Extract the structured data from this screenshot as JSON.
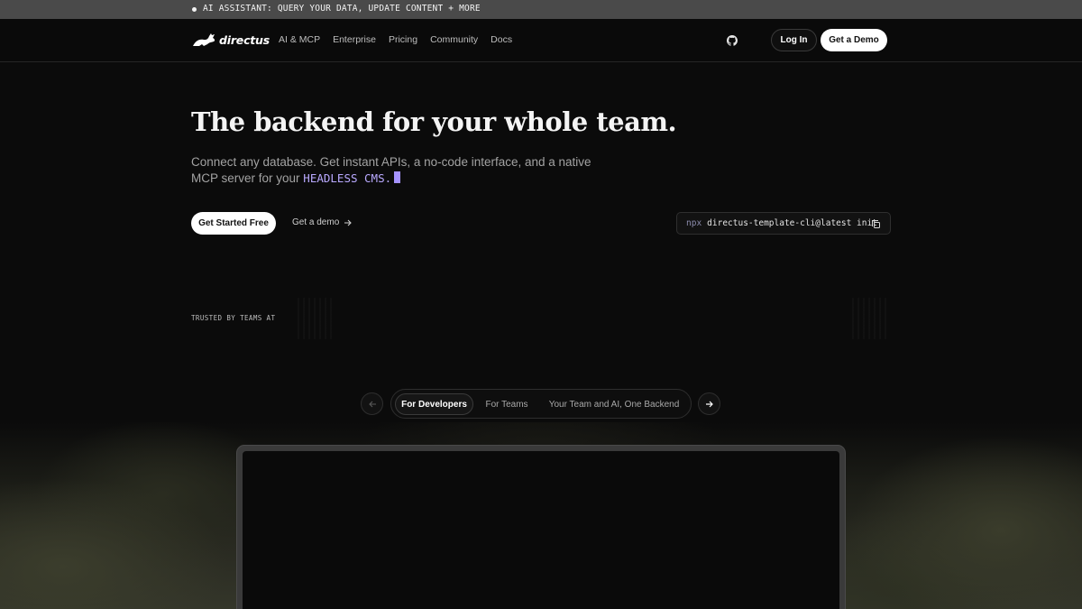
{
  "announcement": {
    "text": "AI ASSISTANT: QUERY YOUR DATA, UPDATE CONTENT + MORE"
  },
  "header": {
    "brand": "directus",
    "nav": [
      "AI & MCP",
      "Enterprise",
      "Pricing",
      "Community",
      "Docs"
    ],
    "login_label": "Log In",
    "demo_label": "Get a Demo"
  },
  "hero": {
    "title": "The backend for your whole team.",
    "subtitle_prefix": "Connect any database. Get instant APIs, a no-code interface, and a native MCP server for your ",
    "subtitle_highlight": "HEADLESS CMS.",
    "primary_cta": "Get Started Free",
    "secondary_cta": "Get a demo",
    "cli_prefix": "npx",
    "cli_command": "directus-template-cli@latest init"
  },
  "trusted": {
    "label": "TRUSTED BY TEAMS AT"
  },
  "tabs": {
    "items": [
      "For Developers",
      "For Teams",
      "Your Team and AI, One Backend"
    ],
    "active_index": 0
  },
  "colors": {
    "accent": "#a593ff",
    "background": "#0b0b0b",
    "announcement_bg": "#4a4a4a"
  },
  "icons": [
    "rabbit-logo-icon",
    "github-icon",
    "arrow-right-icon",
    "copy-icon",
    "arrow-left-icon"
  ]
}
